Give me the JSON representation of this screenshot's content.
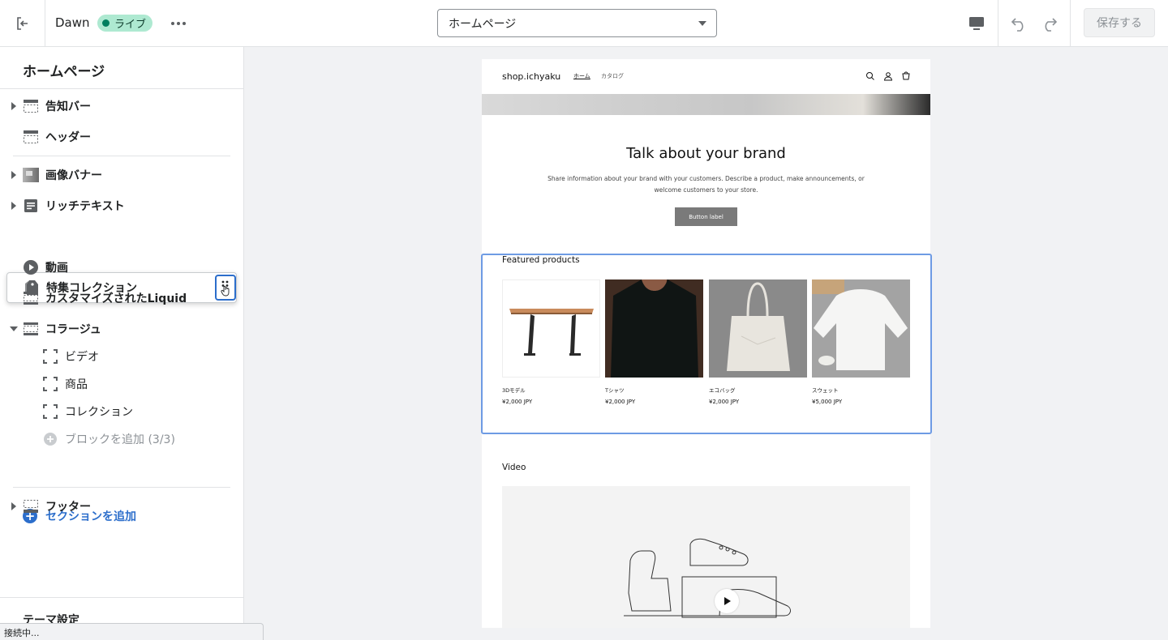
{
  "topbar": {
    "exit_icon": "exit-icon",
    "theme_name": "Dawn",
    "live_badge": "ライブ",
    "more_icon": "more-horizontal-icon",
    "page_select_value": "ホームページ",
    "device_icon": "desktop-icon",
    "undo_icon": "undo-icon",
    "redo_icon": "redo-icon",
    "save_label": "保存する"
  },
  "sidebar": {
    "title": "ホームページ",
    "sections": [
      {
        "label": "告知バー",
        "icon": "announcement-bar-icon",
        "expandable": true
      },
      {
        "label": "ヘッダー",
        "icon": "header-icon",
        "expandable": false
      },
      {
        "label": "画像バナー",
        "icon": "image-banner-icon",
        "expandable": true
      },
      {
        "label": "リッチテキスト",
        "icon": "rich-text-icon",
        "expandable": true
      },
      {
        "label": "特集コレクション",
        "icon": "tag-icon",
        "expandable": false,
        "dragging": true
      },
      {
        "label": "動画",
        "icon": "video-icon",
        "expandable": false
      },
      {
        "label": "カスタマイズされたLiquid",
        "icon": "section-icon",
        "expandable": false
      },
      {
        "label": "コラージュ",
        "icon": "section-icon",
        "expandable": true,
        "expanded": true
      }
    ],
    "collage_blocks": [
      {
        "label": "ビデオ"
      },
      {
        "label": "商品"
      },
      {
        "label": "コレクション"
      }
    ],
    "add_block": "ブロックを追加 (3/3)",
    "add_section": "セクションを追加",
    "footer": "フッター",
    "theme_settings": "テーマ設定"
  },
  "status_bar": "接続中...",
  "preview": {
    "logo": "shop.ichyaku",
    "nav": [
      "ホーム",
      "カタログ"
    ],
    "rich_text": {
      "title": "Talk about your brand",
      "text": "Share information about your brand with your customers. Describe a product, make announcements, or welcome customers to your store.",
      "button": "Button label"
    },
    "featured": {
      "title": "Featured products",
      "products": [
        {
          "name": "3Dモデル",
          "price": "¥2,000 JPY"
        },
        {
          "name": "Tシャツ",
          "price": "¥2,000 JPY"
        },
        {
          "name": "エコバッグ",
          "price": "¥2,000 JPY"
        },
        {
          "name": "スウェット",
          "price": "¥5,000 JPY"
        }
      ]
    },
    "video_title": "Video"
  },
  "colors": {
    "accent": "#2c6ecb",
    "live_badge_bg": "#aee9d1",
    "selection_outline": "#6e9be4"
  }
}
